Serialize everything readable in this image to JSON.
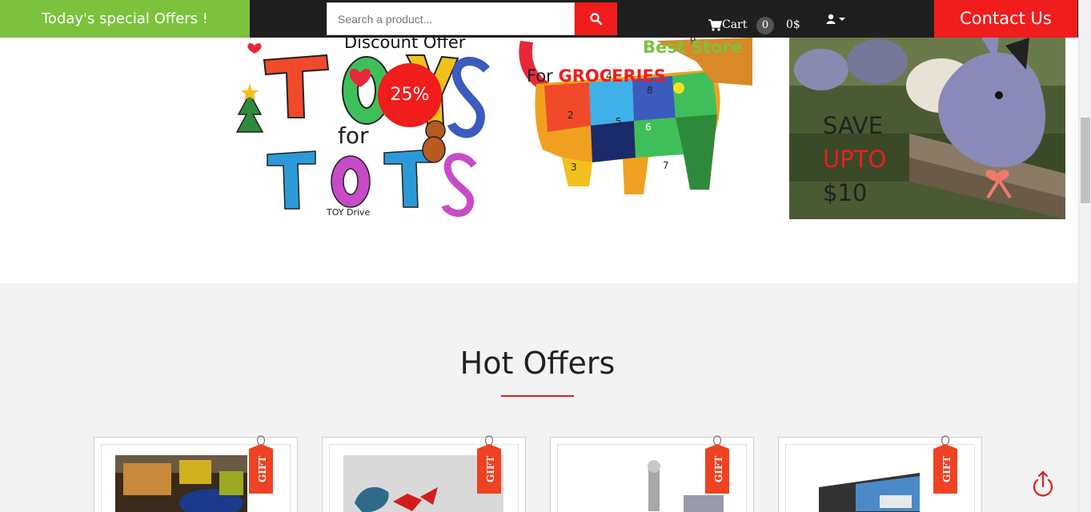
{
  "header": {
    "offers_label": "Today's special Offers !",
    "search_placeholder": "Search a product...",
    "cart_label": "Cart",
    "cart_count": "0",
    "cart_total": "0$",
    "contact_label": "Contact Us"
  },
  "banners": {
    "discount_title": "Discount Offer",
    "discount_badge": "25%",
    "best_store": "Best Store",
    "for_label": "For",
    "groceries_label": "GROCERIES",
    "save_line1": "SAVE",
    "save_line2": "UPTO",
    "save_line3": "$10",
    "toys_art_text": "TOY'S FOR TOTS",
    "toy_drive_text": "TOY Drive"
  },
  "hot_offers": {
    "title": "Hot Offers",
    "gift_label": "GIFT"
  },
  "colors": {
    "accent_green": "#7cc23d",
    "accent_red": "#f11c1c",
    "topbar_dark": "#1f1f1f"
  },
  "icons": [
    "search-icon",
    "cart-icon",
    "user-icon",
    "caret-down-icon",
    "scroll-top-icon",
    "gift-tag-icon"
  ]
}
